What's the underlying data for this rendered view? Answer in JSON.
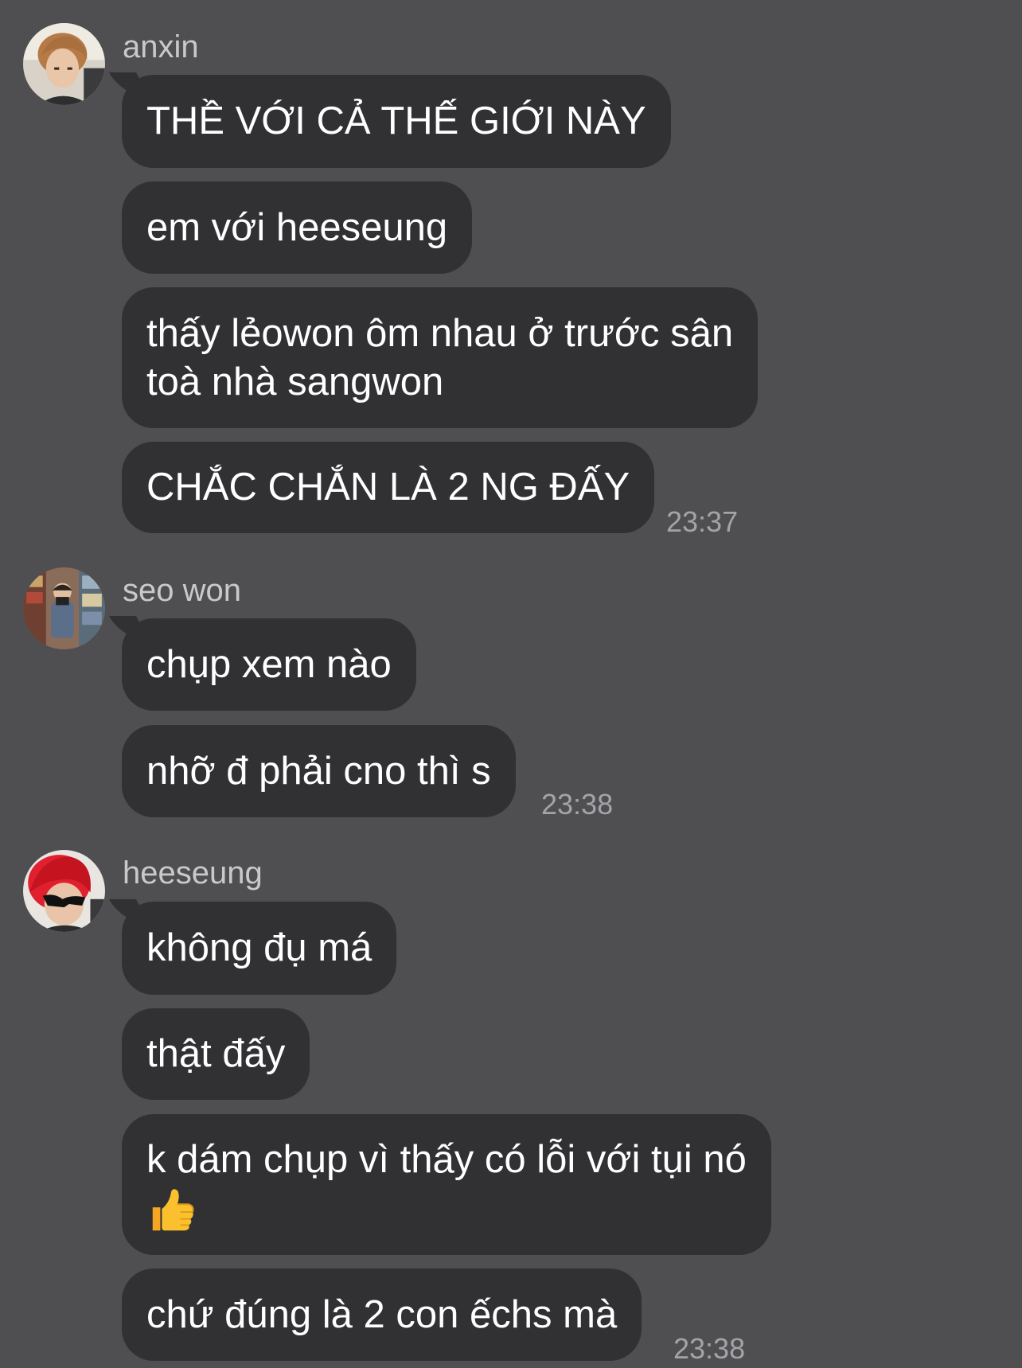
{
  "chat": {
    "groups": [
      {
        "sender": "anxin",
        "avatar_icon": "user-avatar-photo",
        "messages": [
          {
            "lines": [
              "THỀ VỚI CẢ THẾ GIỚI NÀY"
            ]
          },
          {
            "lines": [
              "em với heeseung"
            ]
          },
          {
            "lines": [
              "thấy lẻowon ôm nhau ở trước sân",
              "toà nhà sangwon"
            ]
          },
          {
            "lines": [
              "CHẮC CHẮN LÀ 2 NG ĐẤY"
            ]
          }
        ],
        "time": "23:37"
      },
      {
        "sender": "seo won",
        "avatar_icon": "user-avatar-photo",
        "messages": [
          {
            "lines": [
              "chụp xem nào"
            ]
          },
          {
            "lines": [
              "nhỡ đ phải cno thì s"
            ]
          }
        ],
        "time": "23:38"
      },
      {
        "sender": "heeseung",
        "avatar_icon": "user-avatar-photo",
        "messages": [
          {
            "lines": [
              "không đụ má"
            ]
          },
          {
            "lines": [
              "thật đấy"
            ]
          },
          {
            "lines": [
              "k dám chụp vì thấy có lỗi với tụi nó"
            ],
            "emoji": "thumbs-up-icon"
          },
          {
            "lines": [
              "chứ đúng là 2 con ếchs mà"
            ]
          }
        ],
        "time": "23:38"
      }
    ]
  },
  "colors": {
    "background": "#4f4e50",
    "bubble": "#313033",
    "text": "#ffffff",
    "sender": "#c9c8cc",
    "timestamp": "#a4a3a8"
  }
}
